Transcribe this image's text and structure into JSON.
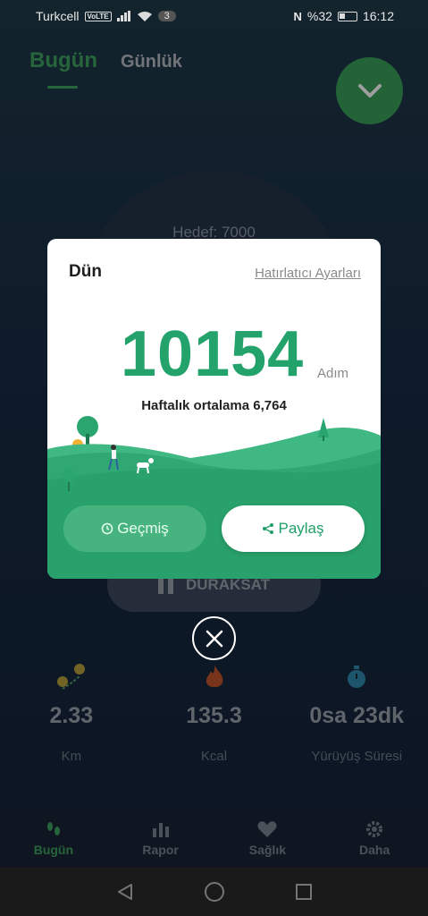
{
  "status_bar": {
    "carrier": "Turkcell",
    "volte": "VoLTE",
    "notification_count": "3",
    "battery": "%32",
    "time": "16:12"
  },
  "header": {
    "tab_today": "Bugün",
    "tab_daily": "Günlük"
  },
  "background": {
    "goal": "Hedef: 7000",
    "pause_label": "DURAKSAT"
  },
  "stats": [
    {
      "value": "2.33",
      "label": "Km",
      "icon": "route-icon"
    },
    {
      "value": "135.3",
      "label": "Kcal",
      "icon": "flame-icon"
    },
    {
      "value": "0sa 23dk",
      "label": "Yürüyüş Süresi",
      "icon": "stopwatch-icon"
    }
  ],
  "bottom_nav": [
    {
      "label": "Bugün",
      "icon": "footprints-icon",
      "active": true
    },
    {
      "label": "Rapor",
      "icon": "bar-chart-icon",
      "active": false
    },
    {
      "label": "Sağlık",
      "icon": "heart-pulse-icon",
      "active": false
    },
    {
      "label": "Daha",
      "icon": "gear-icon",
      "active": false
    }
  ],
  "modal": {
    "title": "Dün",
    "reminder_link": "Hatırlatıcı Ayarları",
    "steps": "10154",
    "unit": "Adım",
    "weekly_average": "Haftalık ortalama 6,764",
    "history_button": "Geçmiş",
    "share_button": "Paylaş"
  },
  "colors": {
    "accent": "#23a26b",
    "modal_green": "#2aa56f"
  }
}
